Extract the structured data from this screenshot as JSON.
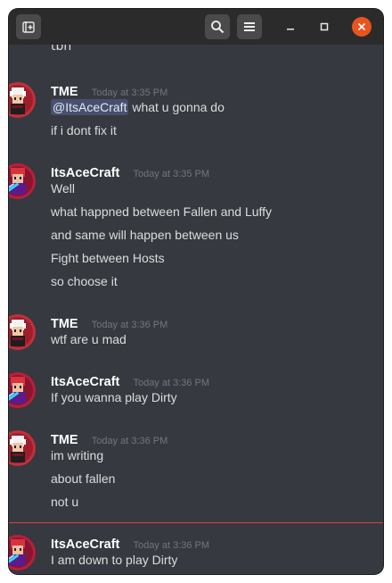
{
  "titlebar": {
    "icons": [
      "new-tab-icon",
      "search-icon",
      "menu-icon",
      "minimize-icon",
      "maximize-icon",
      "close-icon"
    ],
    "close_color": "#e9541f"
  },
  "chat": {
    "partial_line": "tbh",
    "divider_color": "#e04040",
    "messages": [
      {
        "author": "TME",
        "timestamp": "Today at 3:35 PM",
        "mention": "@ItsAceCraft",
        "lines": [
          "what u gonna do",
          "if i dont fix it"
        ]
      },
      {
        "author": "ItsAceCraft",
        "timestamp": "Today at 3:35 PM",
        "lines": [
          "Well",
          "what happned between Fallen and Luffy",
          "and same will happen between us",
          "Fight between Hosts",
          "so choose it"
        ]
      },
      {
        "author": "TME",
        "timestamp": "Today at 3:36 PM",
        "lines": [
          "wtf are u mad"
        ]
      },
      {
        "author": "ItsAceCraft",
        "timestamp": "Today at 3:36 PM",
        "lines": [
          "If you wanna play Dirty"
        ]
      },
      {
        "author": "TME",
        "timestamp": "Today at 3:36 PM",
        "lines": [
          "im writing",
          "about fallen",
          "not u"
        ]
      },
      {
        "author": "ItsAceCraft",
        "timestamp": "Today at 3:36 PM",
        "lines": [
          "I am down to play Dirty"
        ]
      }
    ]
  }
}
